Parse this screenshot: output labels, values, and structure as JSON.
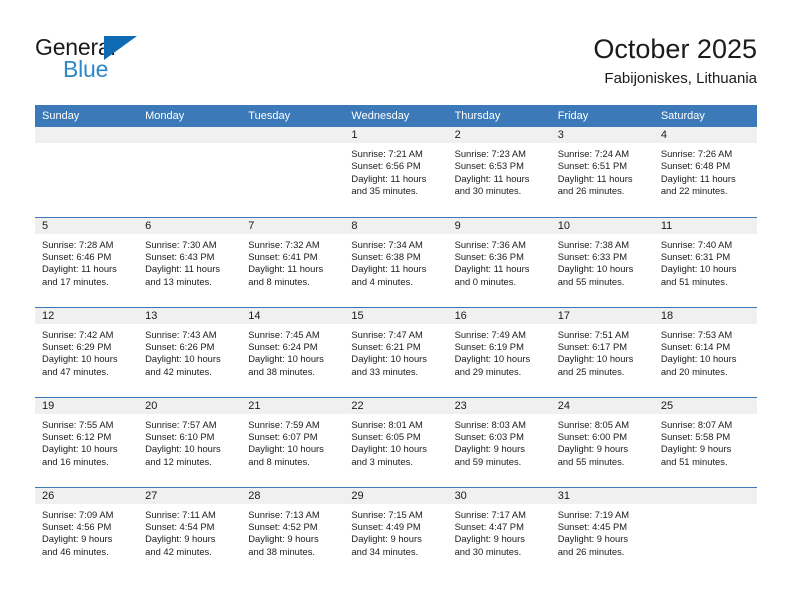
{
  "logo": {
    "word_top": "General",
    "word_bottom": "Blue",
    "triangle_icon": "blue-triangle-icon",
    "colors": {
      "dark": "#1b1b1b",
      "blue": "#2e87c8",
      "triangle": "#0f6ab4"
    }
  },
  "header": {
    "title": "October 2025",
    "subtitle": "Fabijoniskes, Lithuania"
  },
  "theme": {
    "header_row_bg": "#3b79b8",
    "header_row_text": "#ffffff",
    "daynum_band_bg": "#f0f0f0",
    "cell_border": "#3b79b8",
    "text": "#1b1b1b"
  },
  "calendar": {
    "weekday_headers": [
      "Sunday",
      "Monday",
      "Tuesday",
      "Wednesday",
      "Thursday",
      "Friday",
      "Saturday"
    ],
    "weeks": [
      [
        {
          "day": "",
          "sunrise": "",
          "sunset": "",
          "daylight_line1": "",
          "daylight_line2": ""
        },
        {
          "day": "",
          "sunrise": "",
          "sunset": "",
          "daylight_line1": "",
          "daylight_line2": ""
        },
        {
          "day": "",
          "sunrise": "",
          "sunset": "",
          "daylight_line1": "",
          "daylight_line2": ""
        },
        {
          "day": "1",
          "sunrise": "Sunrise: 7:21 AM",
          "sunset": "Sunset: 6:56 PM",
          "daylight_line1": "Daylight: 11 hours",
          "daylight_line2": "and 35 minutes."
        },
        {
          "day": "2",
          "sunrise": "Sunrise: 7:23 AM",
          "sunset": "Sunset: 6:53 PM",
          "daylight_line1": "Daylight: 11 hours",
          "daylight_line2": "and 30 minutes."
        },
        {
          "day": "3",
          "sunrise": "Sunrise: 7:24 AM",
          "sunset": "Sunset: 6:51 PM",
          "daylight_line1": "Daylight: 11 hours",
          "daylight_line2": "and 26 minutes."
        },
        {
          "day": "4",
          "sunrise": "Sunrise: 7:26 AM",
          "sunset": "Sunset: 6:48 PM",
          "daylight_line1": "Daylight: 11 hours",
          "daylight_line2": "and 22 minutes."
        }
      ],
      [
        {
          "day": "5",
          "sunrise": "Sunrise: 7:28 AM",
          "sunset": "Sunset: 6:46 PM",
          "daylight_line1": "Daylight: 11 hours",
          "daylight_line2": "and 17 minutes."
        },
        {
          "day": "6",
          "sunrise": "Sunrise: 7:30 AM",
          "sunset": "Sunset: 6:43 PM",
          "daylight_line1": "Daylight: 11 hours",
          "daylight_line2": "and 13 minutes."
        },
        {
          "day": "7",
          "sunrise": "Sunrise: 7:32 AM",
          "sunset": "Sunset: 6:41 PM",
          "daylight_line1": "Daylight: 11 hours",
          "daylight_line2": "and 8 minutes."
        },
        {
          "day": "8",
          "sunrise": "Sunrise: 7:34 AM",
          "sunset": "Sunset: 6:38 PM",
          "daylight_line1": "Daylight: 11 hours",
          "daylight_line2": "and 4 minutes."
        },
        {
          "day": "9",
          "sunrise": "Sunrise: 7:36 AM",
          "sunset": "Sunset: 6:36 PM",
          "daylight_line1": "Daylight: 11 hours",
          "daylight_line2": "and 0 minutes."
        },
        {
          "day": "10",
          "sunrise": "Sunrise: 7:38 AM",
          "sunset": "Sunset: 6:33 PM",
          "daylight_line1": "Daylight: 10 hours",
          "daylight_line2": "and 55 minutes."
        },
        {
          "day": "11",
          "sunrise": "Sunrise: 7:40 AM",
          "sunset": "Sunset: 6:31 PM",
          "daylight_line1": "Daylight: 10 hours",
          "daylight_line2": "and 51 minutes."
        }
      ],
      [
        {
          "day": "12",
          "sunrise": "Sunrise: 7:42 AM",
          "sunset": "Sunset: 6:29 PM",
          "daylight_line1": "Daylight: 10 hours",
          "daylight_line2": "and 47 minutes."
        },
        {
          "day": "13",
          "sunrise": "Sunrise: 7:43 AM",
          "sunset": "Sunset: 6:26 PM",
          "daylight_line1": "Daylight: 10 hours",
          "daylight_line2": "and 42 minutes."
        },
        {
          "day": "14",
          "sunrise": "Sunrise: 7:45 AM",
          "sunset": "Sunset: 6:24 PM",
          "daylight_line1": "Daylight: 10 hours",
          "daylight_line2": "and 38 minutes."
        },
        {
          "day": "15",
          "sunrise": "Sunrise: 7:47 AM",
          "sunset": "Sunset: 6:21 PM",
          "daylight_line1": "Daylight: 10 hours",
          "daylight_line2": "and 33 minutes."
        },
        {
          "day": "16",
          "sunrise": "Sunrise: 7:49 AM",
          "sunset": "Sunset: 6:19 PM",
          "daylight_line1": "Daylight: 10 hours",
          "daylight_line2": "and 29 minutes."
        },
        {
          "day": "17",
          "sunrise": "Sunrise: 7:51 AM",
          "sunset": "Sunset: 6:17 PM",
          "daylight_line1": "Daylight: 10 hours",
          "daylight_line2": "and 25 minutes."
        },
        {
          "day": "18",
          "sunrise": "Sunrise: 7:53 AM",
          "sunset": "Sunset: 6:14 PM",
          "daylight_line1": "Daylight: 10 hours",
          "daylight_line2": "and 20 minutes."
        }
      ],
      [
        {
          "day": "19",
          "sunrise": "Sunrise: 7:55 AM",
          "sunset": "Sunset: 6:12 PM",
          "daylight_line1": "Daylight: 10 hours",
          "daylight_line2": "and 16 minutes."
        },
        {
          "day": "20",
          "sunrise": "Sunrise: 7:57 AM",
          "sunset": "Sunset: 6:10 PM",
          "daylight_line1": "Daylight: 10 hours",
          "daylight_line2": "and 12 minutes."
        },
        {
          "day": "21",
          "sunrise": "Sunrise: 7:59 AM",
          "sunset": "Sunset: 6:07 PM",
          "daylight_line1": "Daylight: 10 hours",
          "daylight_line2": "and 8 minutes."
        },
        {
          "day": "22",
          "sunrise": "Sunrise: 8:01 AM",
          "sunset": "Sunset: 6:05 PM",
          "daylight_line1": "Daylight: 10 hours",
          "daylight_line2": "and 3 minutes."
        },
        {
          "day": "23",
          "sunrise": "Sunrise: 8:03 AM",
          "sunset": "Sunset: 6:03 PM",
          "daylight_line1": "Daylight: 9 hours",
          "daylight_line2": "and 59 minutes."
        },
        {
          "day": "24",
          "sunrise": "Sunrise: 8:05 AM",
          "sunset": "Sunset: 6:00 PM",
          "daylight_line1": "Daylight: 9 hours",
          "daylight_line2": "and 55 minutes."
        },
        {
          "day": "25",
          "sunrise": "Sunrise: 8:07 AM",
          "sunset": "Sunset: 5:58 PM",
          "daylight_line1": "Daylight: 9 hours",
          "daylight_line2": "and 51 minutes."
        }
      ],
      [
        {
          "day": "26",
          "sunrise": "Sunrise: 7:09 AM",
          "sunset": "Sunset: 4:56 PM",
          "daylight_line1": "Daylight: 9 hours",
          "daylight_line2": "and 46 minutes."
        },
        {
          "day": "27",
          "sunrise": "Sunrise: 7:11 AM",
          "sunset": "Sunset: 4:54 PM",
          "daylight_line1": "Daylight: 9 hours",
          "daylight_line2": "and 42 minutes."
        },
        {
          "day": "28",
          "sunrise": "Sunrise: 7:13 AM",
          "sunset": "Sunset: 4:52 PM",
          "daylight_line1": "Daylight: 9 hours",
          "daylight_line2": "and 38 minutes."
        },
        {
          "day": "29",
          "sunrise": "Sunrise: 7:15 AM",
          "sunset": "Sunset: 4:49 PM",
          "daylight_line1": "Daylight: 9 hours",
          "daylight_line2": "and 34 minutes."
        },
        {
          "day": "30",
          "sunrise": "Sunrise: 7:17 AM",
          "sunset": "Sunset: 4:47 PM",
          "daylight_line1": "Daylight: 9 hours",
          "daylight_line2": "and 30 minutes."
        },
        {
          "day": "31",
          "sunrise": "Sunrise: 7:19 AM",
          "sunset": "Sunset: 4:45 PM",
          "daylight_line1": "Daylight: 9 hours",
          "daylight_line2": "and 26 minutes."
        },
        {
          "day": "",
          "sunrise": "",
          "sunset": "",
          "daylight_line1": "",
          "daylight_line2": ""
        }
      ]
    ]
  }
}
